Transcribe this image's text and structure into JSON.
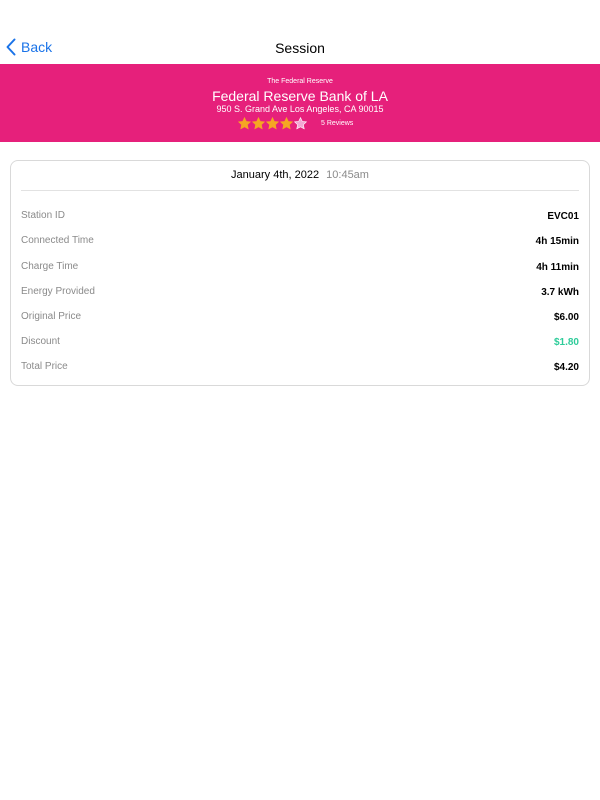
{
  "nav": {
    "back_label": "Back",
    "title": "Session"
  },
  "station": {
    "operator": "The Federal Reserve",
    "name": "Federal Reserve Bank of LA",
    "address": "950 S. Grand Ave Los Angeles, CA 90015",
    "rating": 4,
    "rating_max": 5,
    "reviews_label": "5 Reviews"
  },
  "session": {
    "date": "January 4th, 2022",
    "time": "10:45am",
    "rows": [
      {
        "label": "Station ID",
        "value": "EVC01"
      },
      {
        "label": "Connected Time",
        "value": "4h 15min"
      },
      {
        "label": "Charge Time",
        "value": "4h 11min"
      },
      {
        "label": "Energy Provided",
        "value": "3.7 kWh"
      },
      {
        "label": "Original Price",
        "value": "$6.00"
      },
      {
        "label": "Discount",
        "value": "$1.80"
      },
      {
        "label": "Total Price",
        "value": "$4.20"
      }
    ]
  },
  "colors": {
    "banner": "#e6207b",
    "star_filled": "#f5a623",
    "star_empty": "#f3a6d3",
    "accent": "#1a73e8",
    "discount": "#2ecc9a"
  }
}
